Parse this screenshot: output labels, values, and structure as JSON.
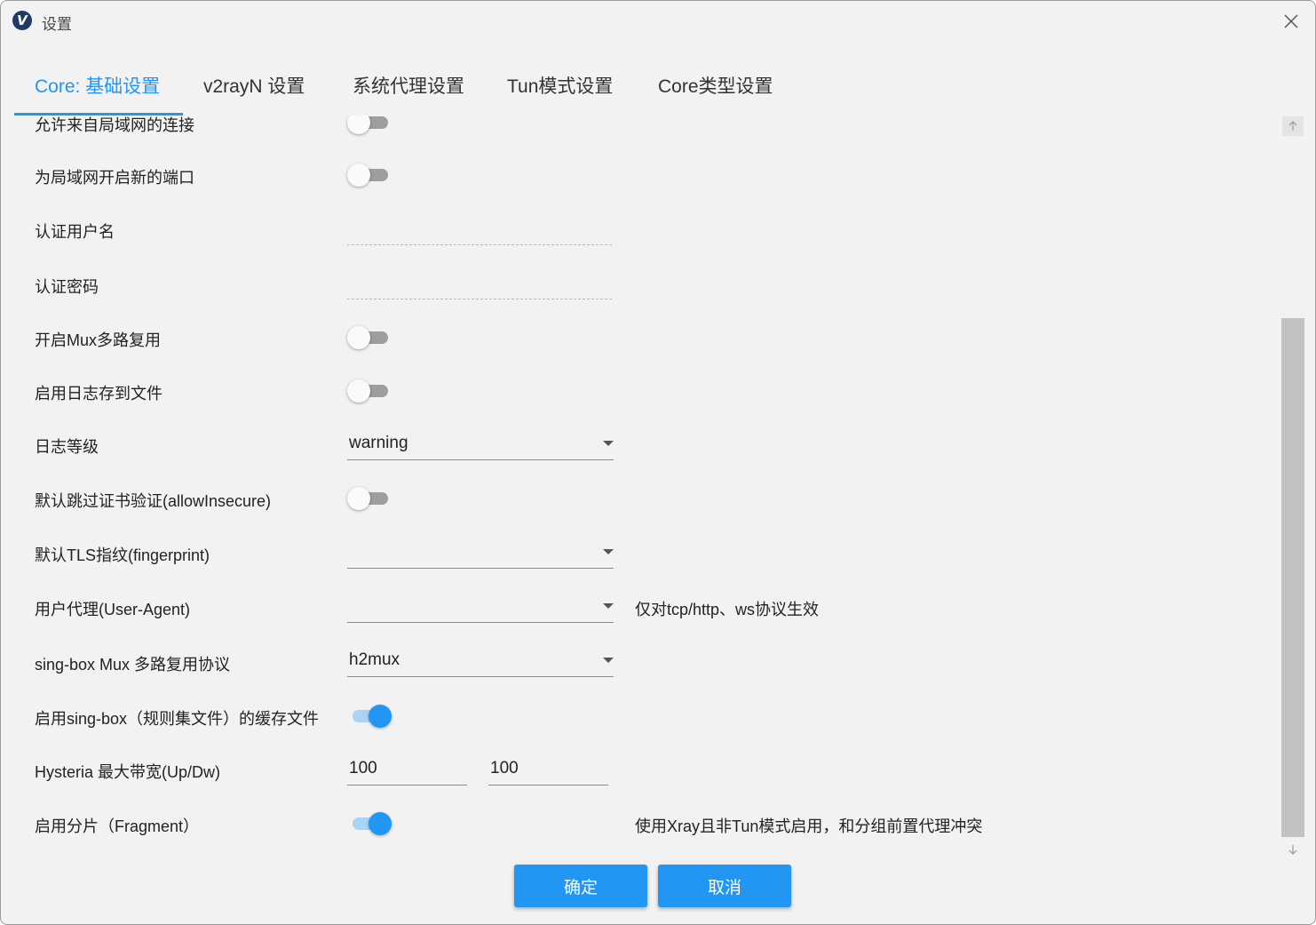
{
  "window": {
    "title": "设置"
  },
  "app_icon": {
    "glyph": "V",
    "icon": "v2rayn-logo-icon"
  },
  "tabs": [
    {
      "label": "Core: 基础设置",
      "active": true
    },
    {
      "label": "v2rayN 设置",
      "active": false
    },
    {
      "label": "系统代理设置",
      "active": false
    },
    {
      "label": "Tun模式设置",
      "active": false
    },
    {
      "label": "Core类型设置",
      "active": false
    }
  ],
  "settings": {
    "allow_lan": {
      "label": "允许来自局域网的连接",
      "checked": false
    },
    "new_lan_port": {
      "label": "为局域网开启新的端口",
      "checked": false
    },
    "auth_user": {
      "label": "认证用户名",
      "value": ""
    },
    "auth_pass": {
      "label": "认证密码",
      "value": ""
    },
    "mux": {
      "label": "开启Mux多路复用",
      "checked": false
    },
    "log_file": {
      "label": "启用日志存到文件",
      "checked": false
    },
    "log_level": {
      "label": "日志等级",
      "value": "warning"
    },
    "allow_insecure": {
      "label": "默认跳过证书验证(allowInsecure)",
      "checked": false
    },
    "tls_fingerprint": {
      "label": "默认TLS指纹(fingerprint)",
      "value": ""
    },
    "user_agent": {
      "label": "用户代理(User-Agent)",
      "value": "",
      "note": "仅对tcp/http、ws协议生效"
    },
    "singbox_mux": {
      "label": "sing-box Mux 多路复用协议",
      "value": "h2mux"
    },
    "singbox_cache": {
      "label": "启用sing-box（规则集文件）的缓存文件",
      "checked": true
    },
    "hysteria_bw": {
      "label": "Hysteria 最大带宽(Up/Dw)",
      "up": "100",
      "down": "100"
    },
    "fragment": {
      "label": "启用分片（Fragment）",
      "checked": true,
      "note": "使用Xray且非Tun模式启用，和分组前置代理冲突"
    }
  },
  "buttons": {
    "ok": "确定",
    "cancel": "取消"
  },
  "colors": {
    "accent": "#2196f3",
    "background": "#f2f2f2"
  }
}
